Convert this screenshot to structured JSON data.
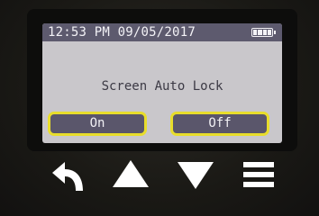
{
  "status_bar": {
    "datetime": "12:53 PM 09/05/2017",
    "battery_icon": "battery-full-icon"
  },
  "dialog": {
    "title": "Screen Auto Lock",
    "options": [
      {
        "label": "On"
      },
      {
        "label": "Off"
      }
    ],
    "highlight_color": "#e8dd2c"
  },
  "keys": {
    "back_icon": "back-arrow-icon",
    "up_icon": "up-triangle-icon",
    "down_icon": "down-triangle-icon",
    "menu_icon": "menu-icon"
  }
}
